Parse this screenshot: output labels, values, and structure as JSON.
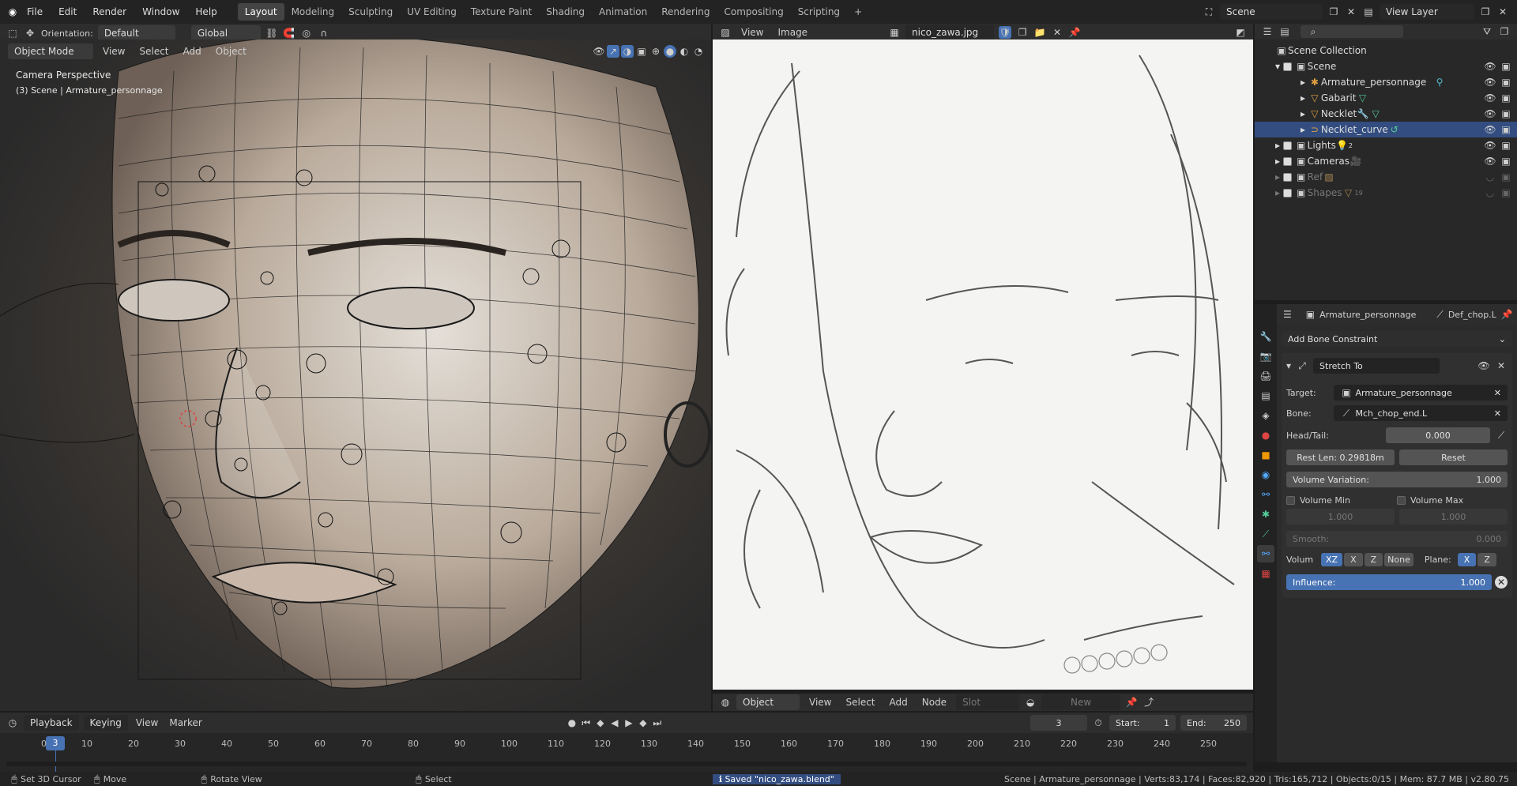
{
  "topbar": {
    "menus": [
      "File",
      "Edit",
      "Render",
      "Window",
      "Help"
    ],
    "workspaces": [
      "Layout",
      "Modeling",
      "Sculpting",
      "UV Editing",
      "Texture Paint",
      "Shading",
      "Animation",
      "Rendering",
      "Compositing",
      "Scripting"
    ],
    "active_workspace": "Layout",
    "add_tab": "+",
    "scene": "Scene",
    "view_layer": "View Layer"
  },
  "viewport": {
    "orientation_label": "Orientation:",
    "orientation": "Default",
    "transform": "Global",
    "mode": "Object Mode",
    "menus": [
      "View",
      "Select",
      "Add",
      "Object"
    ],
    "overlay_title": "Camera Perspective",
    "overlay_sub": "(3) Scene | Armature_personnage"
  },
  "image_editor": {
    "menus": [
      "View",
      "Image"
    ],
    "image_name": "nico_zawa.jpg",
    "footer_type": "Object",
    "footer_menus": [
      "View",
      "Select",
      "Add",
      "Node"
    ],
    "slot": "Slot",
    "new": "New"
  },
  "outliner": {
    "root": "Scene Collection",
    "items": [
      {
        "name": "Scene",
        "depth": 1,
        "selected": false,
        "dim": false
      },
      {
        "name": "Armature_personnage",
        "depth": 2,
        "selected": false,
        "dim": false
      },
      {
        "name": "Gabarit",
        "depth": 2,
        "selected": false,
        "dim": false
      },
      {
        "name": "Necklet",
        "depth": 2,
        "selected": false,
        "dim": false
      },
      {
        "name": "Necklet_curve",
        "depth": 2,
        "selected": true,
        "dim": false
      },
      {
        "name": "Lights",
        "depth": 1,
        "selected": false,
        "dim": false
      },
      {
        "name": "Cameras",
        "depth": 1,
        "selected": false,
        "dim": false
      },
      {
        "name": "Ref",
        "depth": 1,
        "selected": false,
        "dim": true
      },
      {
        "name": "Shapes",
        "depth": 1,
        "selected": false,
        "dim": true
      }
    ],
    "badges": {
      "lights": "2",
      "shapes": "19"
    }
  },
  "properties": {
    "object": "Armature_personnage",
    "bone": "Def_chop.L",
    "add_constraint": "Add Bone Constraint",
    "constraint_name": "Stretch To",
    "target_label": "Target:",
    "target": "Armature_personnage",
    "bone_label": "Bone:",
    "bone_value": "Mch_chop_end.L",
    "headtail_label": "Head/Tail:",
    "headtail": "0.000",
    "rest_len": "Rest Len: 0.29818m",
    "reset": "Reset",
    "volume_variation_label": "Volume Variation:",
    "volume_variation": "1.000",
    "volume_min_label": "Volume Min",
    "volume_max_label": "Volume Max",
    "volume_min": "1.000",
    "volume_max": "1.000",
    "smooth_label": "Smooth:",
    "smooth": "0.000",
    "volum_label": "Volum",
    "volum_options": [
      "XZ",
      "X",
      "Z",
      "None"
    ],
    "plane_label": "Plane:",
    "plane_options": [
      "X",
      "Z"
    ],
    "influence_label": "Influence:",
    "influence": "1.000"
  },
  "timeline": {
    "menus": [
      "Playback",
      "Keying",
      "View",
      "Marker"
    ],
    "current_frame": "3",
    "start_label": "Start:",
    "start": "1",
    "end_label": "End:",
    "end": "250",
    "ticks": [
      "0",
      "10",
      "20",
      "30",
      "40",
      "50",
      "60",
      "70",
      "80",
      "90",
      "100",
      "110",
      "120",
      "130",
      "140",
      "150",
      "160",
      "170",
      "180",
      "190",
      "200",
      "210",
      "220",
      "230",
      "240",
      "250"
    ]
  },
  "status": {
    "set_cursor": "Set 3D Cursor",
    "move": "Move",
    "rotate": "Rotate View",
    "select": "Select",
    "saved": "Saved \"nico_zawa.blend\"",
    "stats": "Scene | Armature_personnage | Verts:83,174 | Faces:82,920 | Tris:165,712 | Objects:0/15 | Mem: 87.7 MB | v2.80.75"
  }
}
